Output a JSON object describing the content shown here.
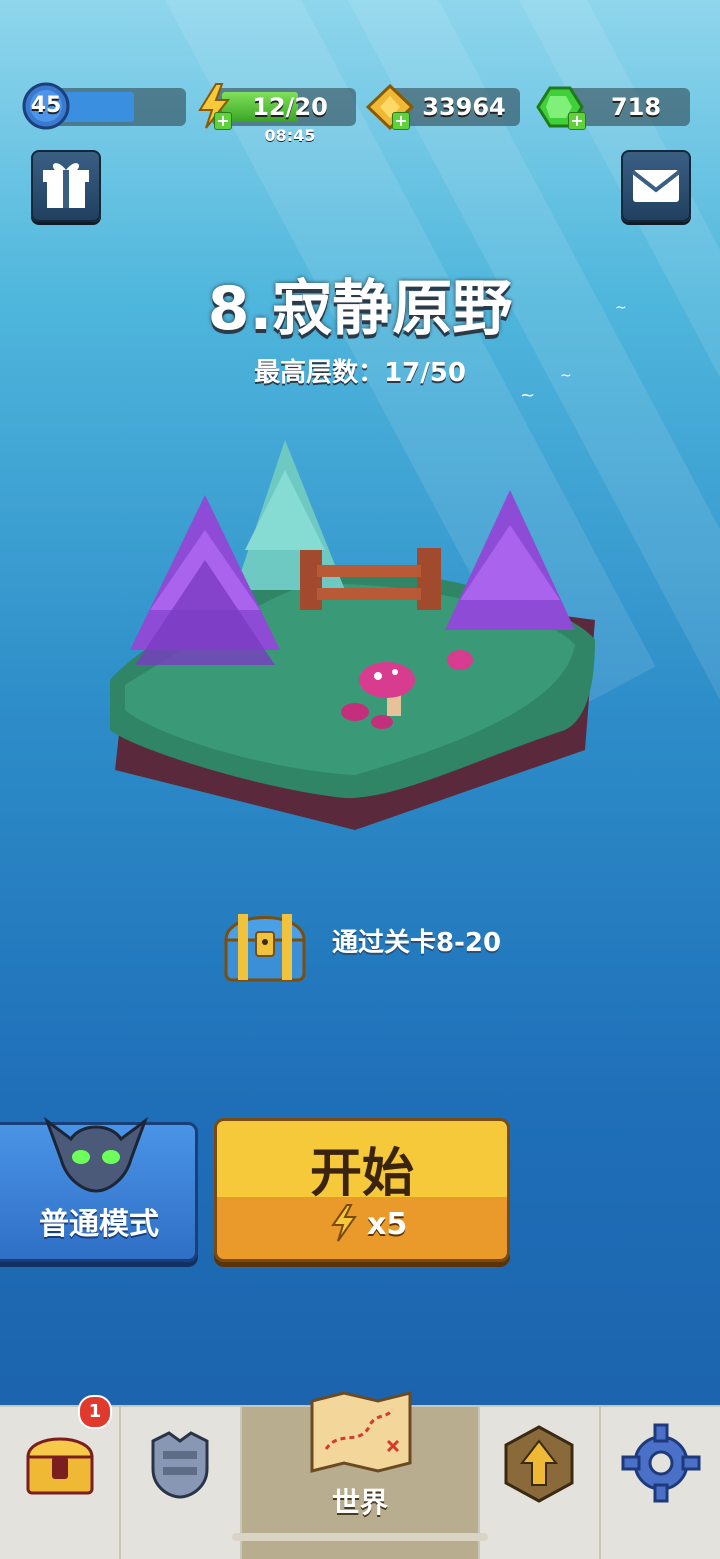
{
  "player": {
    "level": "45"
  },
  "resources": {
    "energy": {
      "value": "12/20",
      "timer": "08:45",
      "fill": 0.6
    },
    "gold": {
      "value": "33964"
    },
    "gems": {
      "value": "718"
    }
  },
  "stage": {
    "title": "8.寂静原野",
    "max_floor": "最高层数：17/50"
  },
  "reward": {
    "text": "通过关卡8-20"
  },
  "mode_button": {
    "label": "普通模式"
  },
  "start_button": {
    "label": "开始",
    "cost": "x5"
  },
  "nav": {
    "active_label": "世界",
    "chest_badge": "1"
  },
  "colors": {
    "start_top": "#f5c93a",
    "start_bottom": "#e99a2a",
    "mode_bg": "#3a7fd6",
    "gem": "#3fd03a",
    "gold": "#f0b935"
  }
}
